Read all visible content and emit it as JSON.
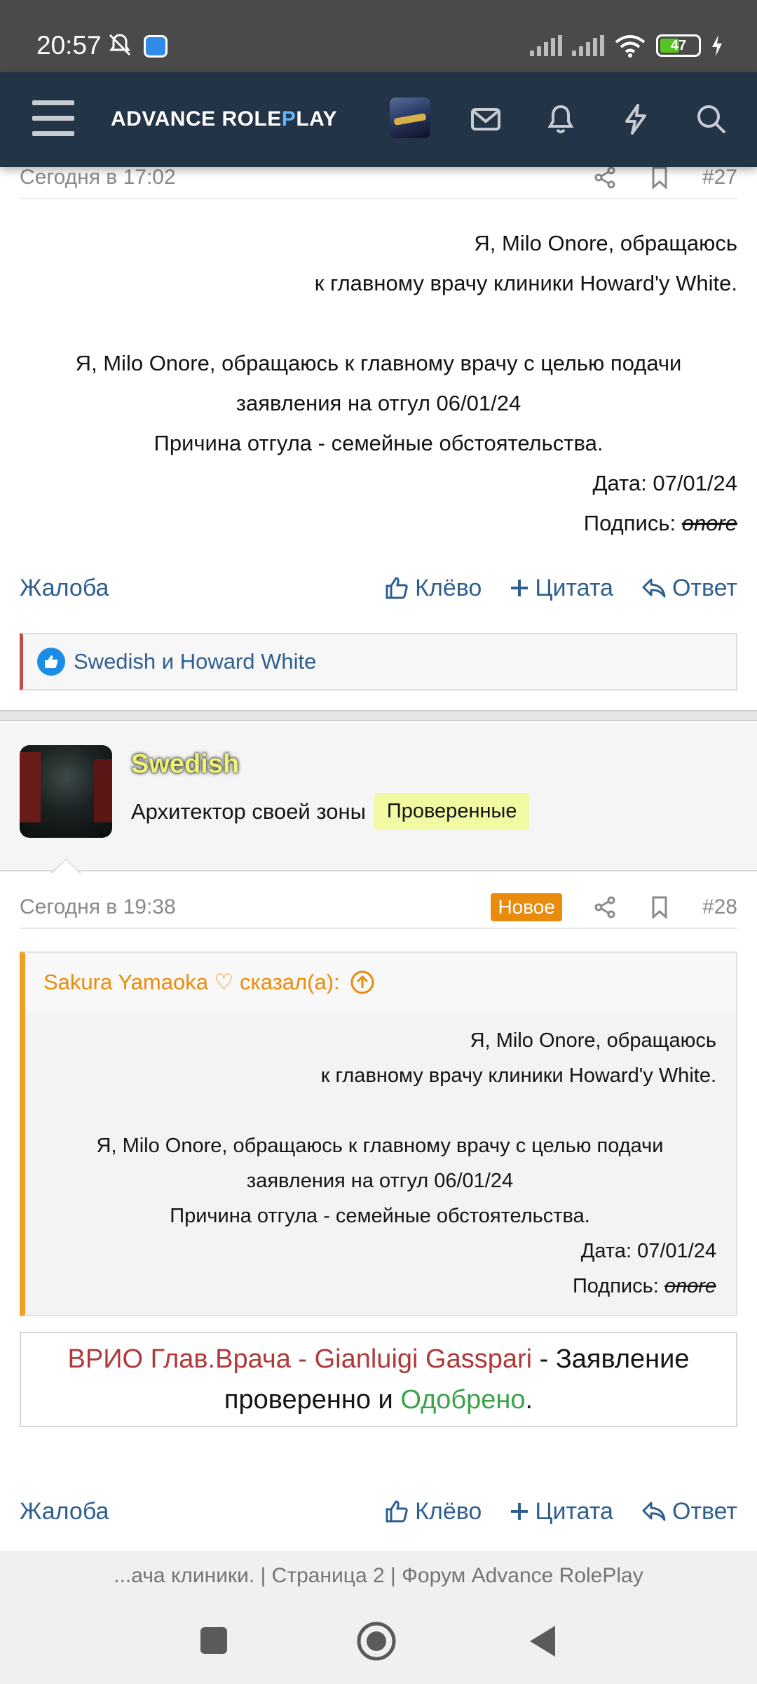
{
  "status_bar": {
    "time": "20:57",
    "battery": "47"
  },
  "app_bar": {
    "logo_part1": "ADVANCE ",
    "logo_part2_a": "ROLE",
    "logo_part2_b": "P",
    "logo_part2_c": "LAY"
  },
  "post27": {
    "date": "Сегодня в 17:02",
    "number": "#27",
    "lines": {
      "l1": "Я, Milo Onore, обращаюсь",
      "l2": "к главному врачу клиники Howard'y White.",
      "l3": "Я, Milo Onore, обращаюсь к главному врачу с целью подачи",
      "l4": "заявления на отгул 06/01/24",
      "l5": "Причина отгула - семейные обстоятельства.",
      "l6": "Дата: 07/01/24",
      "l7_prefix": "Подпись: ",
      "l7_sign": "onore"
    },
    "likes_text": "Swedish и Howard White"
  },
  "actions": {
    "report": "Жалоба",
    "like": "Клёво",
    "quote": "Цитата",
    "reply": "Ответ"
  },
  "user": {
    "name": "Swedish",
    "title": "Архитектор своей зоны",
    "badge": "Проверенные"
  },
  "post28": {
    "date": "Сегодня в 19:38",
    "badge_new": "Новое",
    "number": "#28",
    "quote_header": "Sakura Yamaoka ♡ сказал(а):",
    "quote_lines": {
      "l1": "Я, Milo Onore, обращаюсь",
      "l2": "к главному врачу клиники Howard'y White.",
      "l3": "Я, Milo Onore, обращаюсь к главному врачу с целью подачи",
      "l4": "заявления на отгул 06/01/24",
      "l5": "Причина отгула - семейные обстоятельства.",
      "l6": "Дата: 07/01/24",
      "l7_prefix": "Подпись: ",
      "l7_sign": "onore"
    },
    "verdict": {
      "part1": "ВРИО Глав.Врача - Gianluigi Gasspari",
      "part2": " - Заявление",
      "part3": "проверенно и ",
      "part4": "Одобрено",
      "part5": "."
    }
  },
  "page_title": "...ача клиники. | Страница 2 | Форум Advance RolePlay",
  "colors": {
    "appbar": "#243447",
    "link": "#2f5f8f",
    "accent_orange": "#e98b0c",
    "username": "#eef276",
    "red": "#b03a3a",
    "green": "#3aa24a"
  }
}
